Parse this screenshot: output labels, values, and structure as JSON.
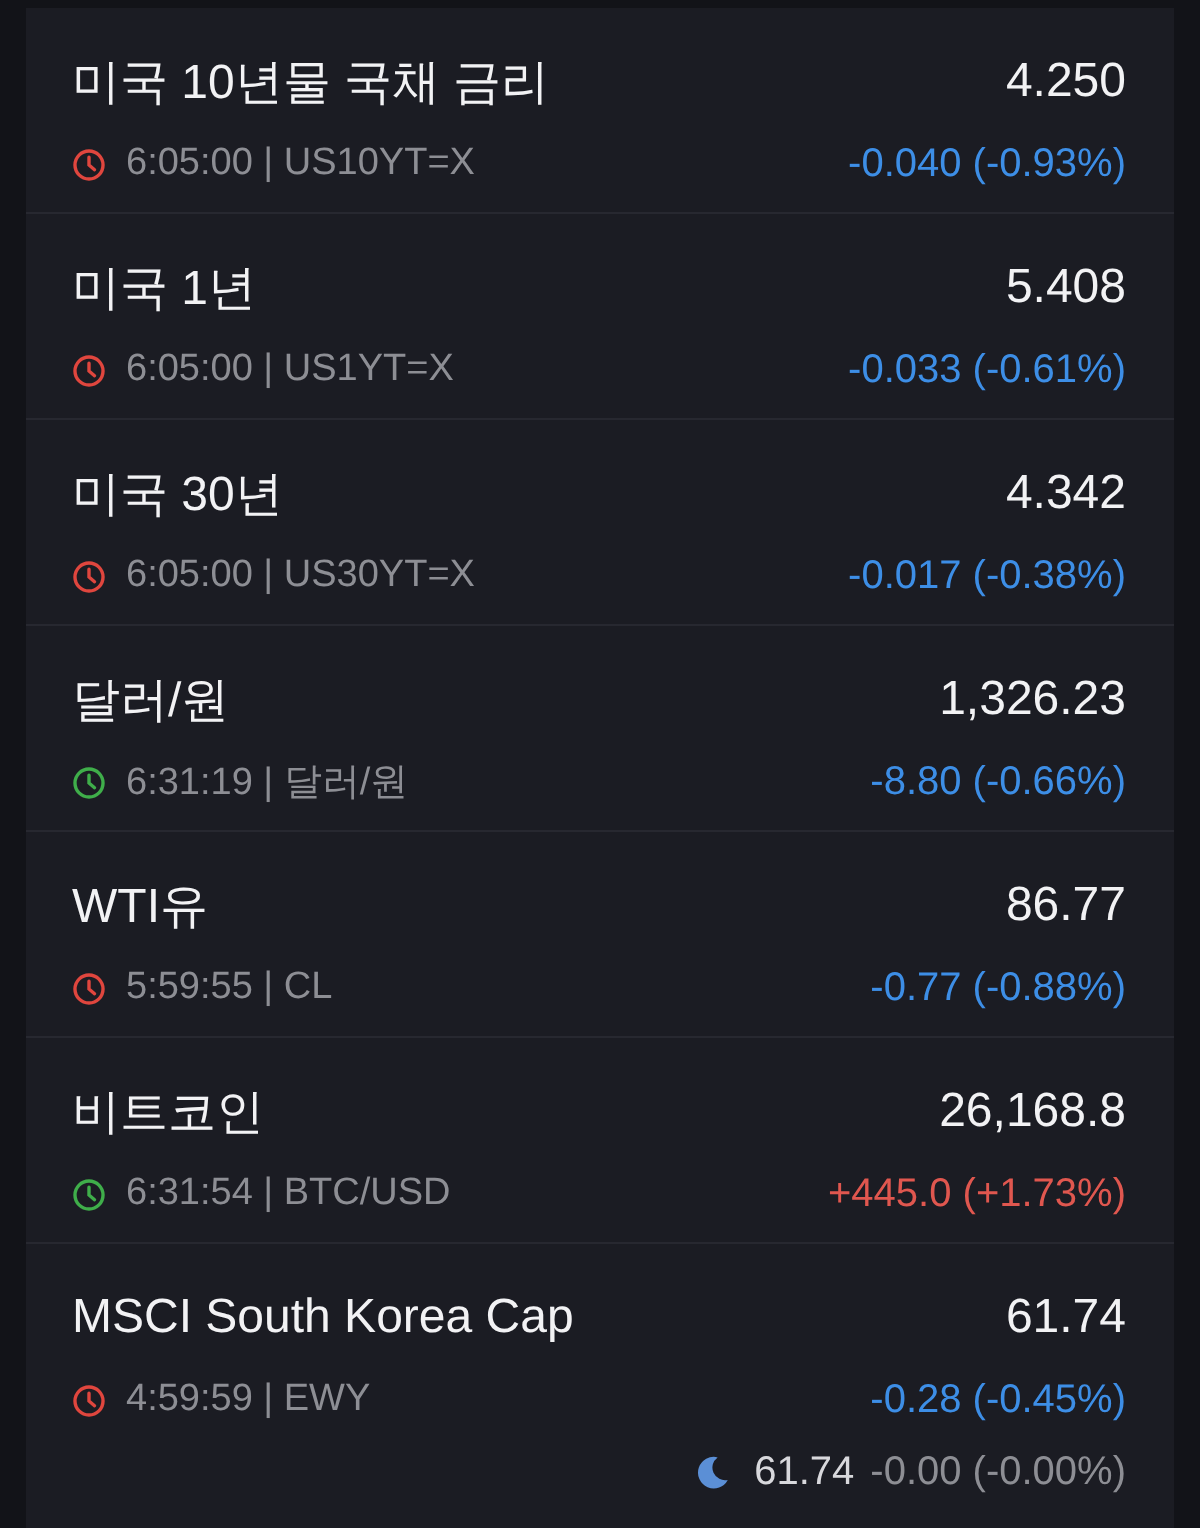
{
  "quotes": [
    {
      "name": "미국 10년물 국채 금리",
      "price": "4.250",
      "market_open": false,
      "info": "6:05:00 | US10YT=X",
      "rising": false,
      "change": "-0.040 (-0.93%)"
    },
    {
      "name": "미국 1년",
      "price": "5.408",
      "market_open": false,
      "info": "6:05:00 | US1YT=X",
      "rising": false,
      "change": "-0.033 (-0.61%)"
    },
    {
      "name": "미국 30년",
      "price": "4.342",
      "market_open": false,
      "info": "6:05:00 | US30YT=X",
      "rising": false,
      "change": "-0.017 (-0.38%)"
    },
    {
      "name": "달러/원",
      "price": "1,326.23",
      "market_open": true,
      "info": "6:31:19 | 달러/원",
      "rising": false,
      "change": "-8.80 (-0.66%)"
    },
    {
      "name": "WTI유",
      "price": "86.77",
      "market_open": false,
      "info": "5:59:55 | CL",
      "rising": false,
      "change": "-0.77 (-0.88%)"
    },
    {
      "name": "비트코인",
      "price": "26,168.8",
      "market_open": true,
      "info": "6:31:54 | BTC/USD",
      "rising": true,
      "change": "+445.0 (+1.73%)"
    },
    {
      "name": "MSCI South Korea Cap",
      "price": "61.74",
      "market_open": false,
      "info": "4:59:59 | EWY",
      "rising": false,
      "change": "-0.28 (-0.45%)",
      "after_hours": {
        "price": "61.74",
        "change": "-0.00 (-0.00%)"
      }
    }
  ]
}
